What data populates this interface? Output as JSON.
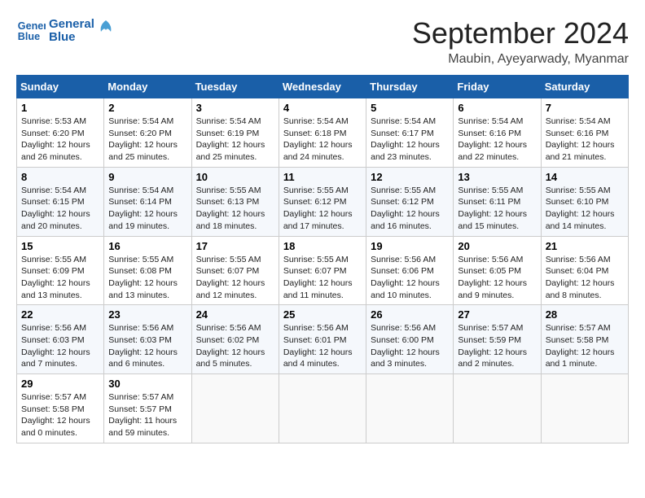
{
  "logo": {
    "line1": "General",
    "line2": "Blue"
  },
  "title": "September 2024",
  "location": "Maubin, Ayeyarwady, Myanmar",
  "header_days": [
    "Sunday",
    "Monday",
    "Tuesday",
    "Wednesday",
    "Thursday",
    "Friday",
    "Saturday"
  ],
  "weeks": [
    [
      {
        "day": "1",
        "detail": "Sunrise: 5:53 AM\nSunset: 6:20 PM\nDaylight: 12 hours\nand 26 minutes."
      },
      {
        "day": "2",
        "detail": "Sunrise: 5:54 AM\nSunset: 6:20 PM\nDaylight: 12 hours\nand 25 minutes."
      },
      {
        "day": "3",
        "detail": "Sunrise: 5:54 AM\nSunset: 6:19 PM\nDaylight: 12 hours\nand 25 minutes."
      },
      {
        "day": "4",
        "detail": "Sunrise: 5:54 AM\nSunset: 6:18 PM\nDaylight: 12 hours\nand 24 minutes."
      },
      {
        "day": "5",
        "detail": "Sunrise: 5:54 AM\nSunset: 6:17 PM\nDaylight: 12 hours\nand 23 minutes."
      },
      {
        "day": "6",
        "detail": "Sunrise: 5:54 AM\nSunset: 6:16 PM\nDaylight: 12 hours\nand 22 minutes."
      },
      {
        "day": "7",
        "detail": "Sunrise: 5:54 AM\nSunset: 6:16 PM\nDaylight: 12 hours\nand 21 minutes."
      }
    ],
    [
      {
        "day": "8",
        "detail": "Sunrise: 5:54 AM\nSunset: 6:15 PM\nDaylight: 12 hours\nand 20 minutes."
      },
      {
        "day": "9",
        "detail": "Sunrise: 5:54 AM\nSunset: 6:14 PM\nDaylight: 12 hours\nand 19 minutes."
      },
      {
        "day": "10",
        "detail": "Sunrise: 5:55 AM\nSunset: 6:13 PM\nDaylight: 12 hours\nand 18 minutes."
      },
      {
        "day": "11",
        "detail": "Sunrise: 5:55 AM\nSunset: 6:12 PM\nDaylight: 12 hours\nand 17 minutes."
      },
      {
        "day": "12",
        "detail": "Sunrise: 5:55 AM\nSunset: 6:12 PM\nDaylight: 12 hours\nand 16 minutes."
      },
      {
        "day": "13",
        "detail": "Sunrise: 5:55 AM\nSunset: 6:11 PM\nDaylight: 12 hours\nand 15 minutes."
      },
      {
        "day": "14",
        "detail": "Sunrise: 5:55 AM\nSunset: 6:10 PM\nDaylight: 12 hours\nand 14 minutes."
      }
    ],
    [
      {
        "day": "15",
        "detail": "Sunrise: 5:55 AM\nSunset: 6:09 PM\nDaylight: 12 hours\nand 13 minutes."
      },
      {
        "day": "16",
        "detail": "Sunrise: 5:55 AM\nSunset: 6:08 PM\nDaylight: 12 hours\nand 13 minutes."
      },
      {
        "day": "17",
        "detail": "Sunrise: 5:55 AM\nSunset: 6:07 PM\nDaylight: 12 hours\nand 12 minutes."
      },
      {
        "day": "18",
        "detail": "Sunrise: 5:55 AM\nSunset: 6:07 PM\nDaylight: 12 hours\nand 11 minutes."
      },
      {
        "day": "19",
        "detail": "Sunrise: 5:56 AM\nSunset: 6:06 PM\nDaylight: 12 hours\nand 10 minutes."
      },
      {
        "day": "20",
        "detail": "Sunrise: 5:56 AM\nSunset: 6:05 PM\nDaylight: 12 hours\nand 9 minutes."
      },
      {
        "day": "21",
        "detail": "Sunrise: 5:56 AM\nSunset: 6:04 PM\nDaylight: 12 hours\nand 8 minutes."
      }
    ],
    [
      {
        "day": "22",
        "detail": "Sunrise: 5:56 AM\nSunset: 6:03 PM\nDaylight: 12 hours\nand 7 minutes."
      },
      {
        "day": "23",
        "detail": "Sunrise: 5:56 AM\nSunset: 6:03 PM\nDaylight: 12 hours\nand 6 minutes."
      },
      {
        "day": "24",
        "detail": "Sunrise: 5:56 AM\nSunset: 6:02 PM\nDaylight: 12 hours\nand 5 minutes."
      },
      {
        "day": "25",
        "detail": "Sunrise: 5:56 AM\nSunset: 6:01 PM\nDaylight: 12 hours\nand 4 minutes."
      },
      {
        "day": "26",
        "detail": "Sunrise: 5:56 AM\nSunset: 6:00 PM\nDaylight: 12 hours\nand 3 minutes."
      },
      {
        "day": "27",
        "detail": "Sunrise: 5:57 AM\nSunset: 5:59 PM\nDaylight: 12 hours\nand 2 minutes."
      },
      {
        "day": "28",
        "detail": "Sunrise: 5:57 AM\nSunset: 5:58 PM\nDaylight: 12 hours\nand 1 minute."
      }
    ],
    [
      {
        "day": "29",
        "detail": "Sunrise: 5:57 AM\nSunset: 5:58 PM\nDaylight: 12 hours\nand 0 minutes."
      },
      {
        "day": "30",
        "detail": "Sunrise: 5:57 AM\nSunset: 5:57 PM\nDaylight: 11 hours\nand 59 minutes."
      },
      {
        "day": "",
        "detail": ""
      },
      {
        "day": "",
        "detail": ""
      },
      {
        "day": "",
        "detail": ""
      },
      {
        "day": "",
        "detail": ""
      },
      {
        "day": "",
        "detail": ""
      }
    ]
  ]
}
